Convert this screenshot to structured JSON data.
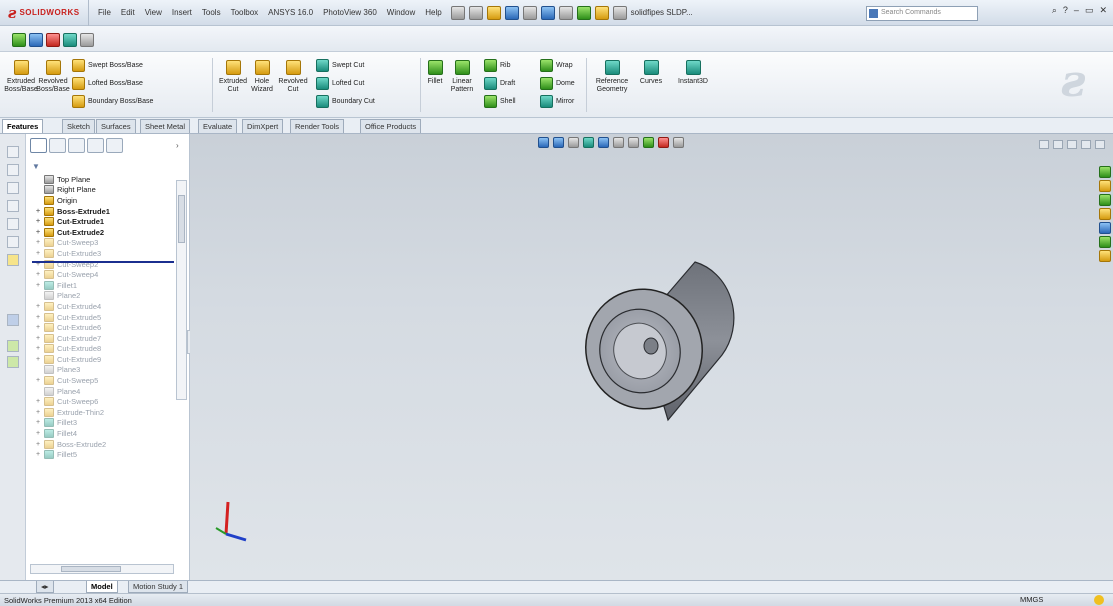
{
  "app": {
    "brand": "SOLIDWORKS",
    "file_title": "solidfipes SLDP...",
    "search_placeholder": "Search Commands"
  },
  "menu": [
    "File",
    "Edit",
    "View",
    "Insert",
    "Tools",
    "Toolbox",
    "ANSYS 16.0",
    "PhotoView 360",
    "Window",
    "Help"
  ],
  "command_manager": {
    "extruded_boss": "Extruded Boss/Base",
    "revolved_boss": "Revolved Boss/Base",
    "swept_boss": "Swept Boss/Base",
    "lofted_boss": "Lofted Boss/Base",
    "boundary_boss": "Boundary Boss/Base",
    "extruded_cut": "Extruded Cut",
    "hole_wizard": "Hole Wizard",
    "revolved_cut": "Revolved Cut",
    "swept_cut": "Swept Cut",
    "lofted_cut": "Lofted Cut",
    "boundary_cut": "Boundary Cut",
    "fillet": "Fillet",
    "linear_pattern": "Linear Pattern",
    "rib": "Rib",
    "draft": "Draft",
    "shell": "Shell",
    "wrap": "Wrap",
    "dome": "Dome",
    "mirror": "Mirror",
    "reference_geometry": "Reference Geometry",
    "curves": "Curves",
    "instant3d": "Instant3D"
  },
  "tabs": [
    "Features",
    "Sketch",
    "Surfaces",
    "Sheet Metal",
    "Evaluate",
    "DimXpert",
    "Render Tools",
    "Office Products"
  ],
  "feature_tree": [
    {
      "label": "Top Plane",
      "type": "plane",
      "suppressed": false
    },
    {
      "label": "Right Plane",
      "type": "plane",
      "suppressed": false
    },
    {
      "label": "Origin",
      "type": "origin",
      "suppressed": false
    },
    {
      "label": "Boss-Extrude1",
      "type": "boss",
      "suppressed": false
    },
    {
      "label": "Cut-Extrude1",
      "type": "cut",
      "suppressed": false
    },
    {
      "label": "Cut-Extrude2",
      "type": "cut",
      "suppressed": false
    },
    {
      "label": "Cut-Sweep3",
      "type": "cut",
      "suppressed": true
    },
    {
      "label": "Cut-Extrude3",
      "type": "cut",
      "suppressed": true
    },
    {
      "label": "Cut-Sweep2",
      "type": "cut",
      "suppressed": true
    },
    {
      "label": "Cut-Sweep4",
      "type": "cut",
      "suppressed": true
    },
    {
      "label": "Fillet1",
      "type": "fillet",
      "suppressed": true
    },
    {
      "label": "Plane2",
      "type": "plane",
      "suppressed": true
    },
    {
      "label": "Cut-Extrude4",
      "type": "cut",
      "suppressed": true
    },
    {
      "label": "Cut-Extrude5",
      "type": "cut",
      "suppressed": true
    },
    {
      "label": "Cut-Extrude6",
      "type": "cut",
      "suppressed": true
    },
    {
      "label": "Cut-Extrude7",
      "type": "cut",
      "suppressed": true
    },
    {
      "label": "Cut-Extrude8",
      "type": "cut",
      "suppressed": true
    },
    {
      "label": "Cut-Extrude9",
      "type": "cut",
      "suppressed": true
    },
    {
      "label": "Plane3",
      "type": "plane",
      "suppressed": true
    },
    {
      "label": "Cut-Sweep5",
      "type": "cut",
      "suppressed": true
    },
    {
      "label": "Plane4",
      "type": "plane",
      "suppressed": true
    },
    {
      "label": "Cut-Sweep6",
      "type": "cut",
      "suppressed": true
    },
    {
      "label": "Extrude-Thin2",
      "type": "boss",
      "suppressed": true
    },
    {
      "label": "Fillet3",
      "type": "fillet",
      "suppressed": true
    },
    {
      "label": "Fillet4",
      "type": "fillet",
      "suppressed": true
    },
    {
      "label": "Boss-Extrude2",
      "type": "boss",
      "suppressed": true
    },
    {
      "label": "Fillet5",
      "type": "fillet",
      "suppressed": true
    }
  ],
  "bottom_tabs": [
    "Model",
    "Motion Study 1"
  ],
  "status": {
    "edition": "SolidWorks Premium 2013 x64 Edition",
    "units": "MMGS"
  },
  "colors": {
    "brand_red": "#c8201d",
    "rollback_bar": "#1b2f8f",
    "viewport_bg": "#d5dbe2",
    "part_grey": "#8c9099"
  }
}
